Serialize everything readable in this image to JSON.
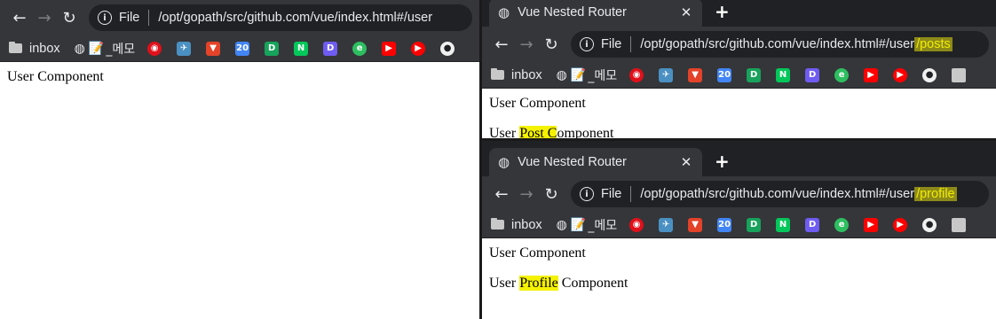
{
  "tab_title": "Vue Nested Router",
  "file_label": "File",
  "bookmarks": {
    "folder_label": "inbox",
    "memo_label": "_메모"
  },
  "windows": {
    "left": {
      "url": "/opt/gopath/src/github.com/vue/index.html#/user",
      "content": {
        "line1": "User Component"
      }
    },
    "top_right": {
      "url_base": "/opt/gopath/src/github.com/vue/index.html#/user",
      "url_highlight": "/posts",
      "content": {
        "line1": "User Component",
        "line2_prefix": "User ",
        "line2_highlight": "Post C",
        "line2_suffix": "omponent"
      }
    },
    "bottom_right": {
      "url_base": "/opt/gopath/src/github.com/vue/index.html#/user",
      "url_highlight": "/profile",
      "content": {
        "line1": "User Component",
        "line2_prefix": "User ",
        "line2_highlight": "Profile",
        "line2_suffix": " Component"
      }
    }
  },
  "bookmark_icons": [
    {
      "name": "red-circle-icon",
      "color": "#e0101a"
    },
    {
      "name": "bird-icon",
      "color": "#4a90c2"
    },
    {
      "name": "gitlab-icon",
      "color": "#e24329"
    },
    {
      "name": "calendar-20-icon",
      "color": "#4285f4"
    },
    {
      "name": "green-d-icon",
      "color": "#17a35b"
    },
    {
      "name": "naver-n-icon",
      "color": "#03c75a"
    },
    {
      "name": "d-letter-icon",
      "color": "#6f5cf2"
    },
    {
      "name": "evernote-icon",
      "color": "#2dbe60"
    },
    {
      "name": "youtube-icon",
      "color": "#ff0000"
    },
    {
      "name": "youtube-music-icon",
      "color": "#ff0000"
    },
    {
      "name": "github-icon",
      "color": "#f0f0f0"
    }
  ],
  "colors": {
    "highlight": "#f5f200",
    "url_highlight": "#f2ee00",
    "chrome_dark": "#202124",
    "chrome_toolbar": "#35363a"
  }
}
